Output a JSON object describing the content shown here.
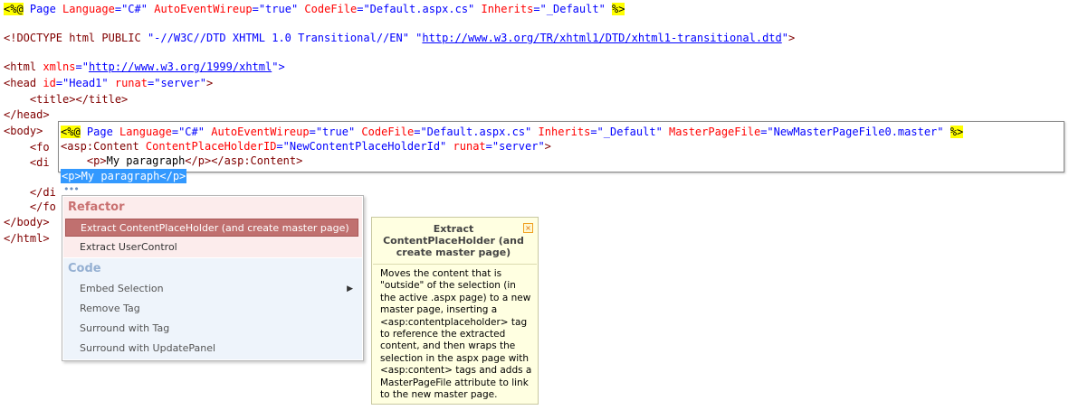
{
  "code": {
    "line1": {
      "open": "<%@",
      "kw_page": " Page ",
      "a1": "Language",
      "v1": "\"C#\"",
      "a2": "AutoEventWireup",
      "v2": "\"true\"",
      "a3": "CodeFile",
      "v3": "\"Default.aspx.cs\"",
      "a4": "Inherits",
      "v4": "\"_Default\"",
      "close": "%>"
    },
    "line2": {
      "start": "<!DOCTYPE html PUBLIC ",
      "v1": "\"-//W3C//DTD XHTML 1.0 Transitional//EN\"",
      "q1": "\"",
      "link": "http://www.w3.org/TR/xhtml1/DTD/xhtml1-transitional.dtd",
      "q2": "\"",
      "end": ">"
    },
    "line3": {
      "start": "<html ",
      "attr": "xmlns",
      "eq": "=\"",
      "link": "http://www.w3.org/1999/xhtml",
      "end": "\">"
    },
    "line4": {
      "start": "<head ",
      "a1": "id",
      "v1": "\"Head1\"",
      "a2": "runat",
      "v2": "\"server\"",
      "end": ">"
    },
    "line5": {
      "indent": "    ",
      "text": "<title></title>"
    },
    "line6": "</head>",
    "line7": "<body>",
    "line8": {
      "indent": "    ",
      "text": "<fo"
    },
    "line9": {
      "indent": "    ",
      "text": "<di"
    },
    "line10": {
      "indent": "    ",
      "text": "</di"
    },
    "line11": {
      "indent": "    ",
      "text": "</fo"
    },
    "line12": "</body>",
    "line13": "</html>"
  },
  "preview": {
    "l1": {
      "open": "<%@",
      "kw_page": " Page ",
      "a1": "Language",
      "v1": "\"C#\"",
      "a2": "AutoEventWireup",
      "v2": "\"true\"",
      "a3": "CodeFile",
      "v3": "\"Default.aspx.cs\"",
      "a4": "Inherits",
      "v4": "\"_Default\"",
      "a5": "MasterPageFile",
      "v5": "\"NewMasterPageFile0.master\"",
      "close": "%>"
    },
    "l2": {
      "tag": "<asp:Content ",
      "a1": "ContentPlaceHolderID",
      "v1": "\"NewContentPlaceHolderId\"",
      "a2": "runat",
      "v2": "\"server\"",
      "end": ">"
    },
    "l3": {
      "indent": "    ",
      "open": "<p>",
      "text": "My paragraph",
      "close": "</p></asp:Content>"
    }
  },
  "selection": "<p>My paragraph</p>",
  "smart_tag": "•••",
  "menu": {
    "refactor_header": "Refactor",
    "refactor_items": [
      {
        "label": "Extract ContentPlaceHolder (and create master page)",
        "active": true
      },
      {
        "label": "Extract UserControl"
      }
    ],
    "code_header": "Code",
    "code_items": [
      {
        "label": "Embed Selection",
        "submenu": "▶"
      },
      {
        "label": "Remove Tag"
      },
      {
        "label": "Surround with Tag"
      },
      {
        "label": "Surround with UpdatePanel"
      }
    ]
  },
  "tooltip": {
    "title": "Extract ContentPlaceHolder (and create master page)",
    "close": "×",
    "body": "Moves the content that is \"outside\" of the selection (in the active .aspx page) to a new master page, inserting a <asp:contentplaceholder> tag to reference the extracted content, and then wraps the selection in the aspx page with <asp:content> tags and adds a MasterPageFile attribute to link to the new master page."
  }
}
